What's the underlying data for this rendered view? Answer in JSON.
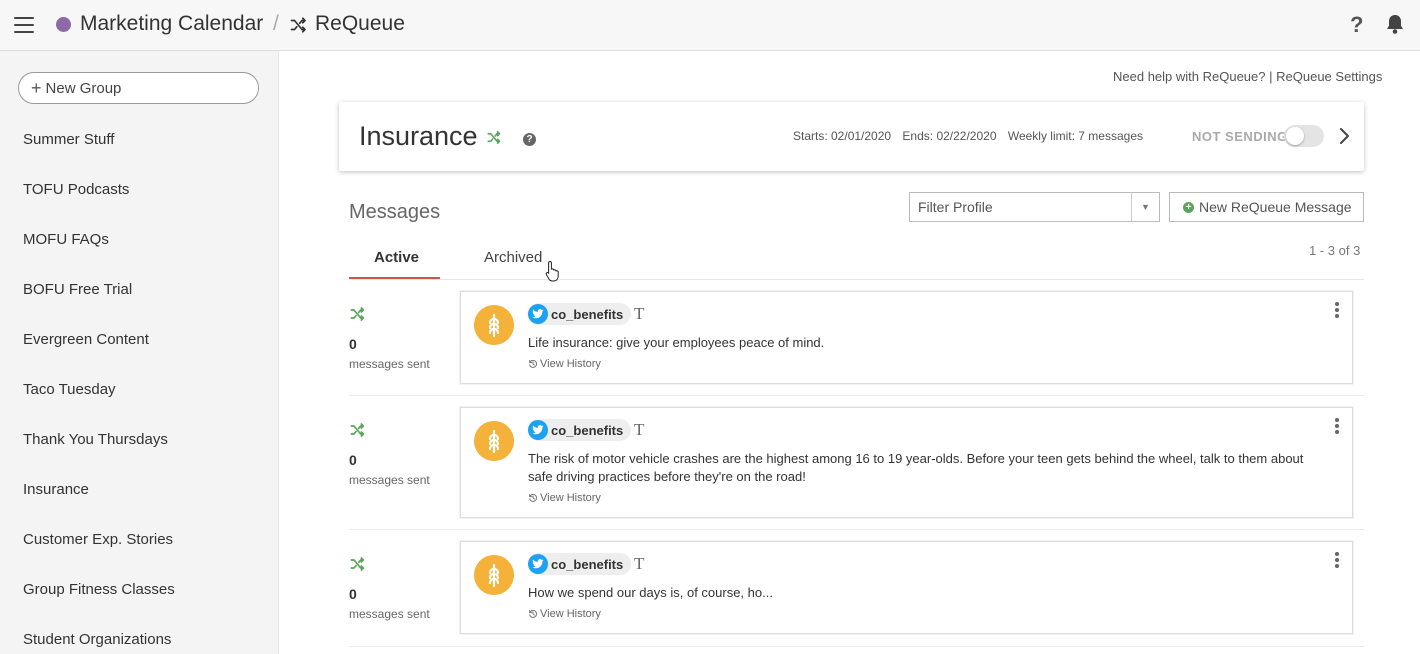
{
  "header": {
    "calendar_name": "Marketing Calendar",
    "separator": "/",
    "current": "ReQueue",
    "help_glyph": "?",
    "calendar_color": "#8c6aa8"
  },
  "sidebar": {
    "new_group_label": "New Group",
    "groups": [
      "Summer Stuff",
      "TOFU Podcasts",
      "MOFU FAQs",
      "BOFU Free Trial",
      "Evergreen Content",
      "Taco Tuesday",
      "Thank You Thursdays",
      "Insurance",
      "Customer Exp. Stories",
      "Group Fitness Classes",
      "Student Organizations"
    ]
  },
  "help_links": {
    "help": "Need help with ReQueue?",
    "divider": "|",
    "settings": "ReQueue Settings"
  },
  "queue": {
    "name": "Insurance",
    "help_glyph": "?",
    "starts": "Starts: 02/01/2020",
    "ends": "Ends: 02/22/2020",
    "weekly_limit": "Weekly limit: 7 messages",
    "status": "NOT SENDING",
    "toggle_on": false
  },
  "messages": {
    "title": "Messages",
    "filter_placeholder": "Filter Profile",
    "new_button": "New ReQueue Message",
    "tabs": [
      "Active",
      "Archived"
    ],
    "active_tab": "Active",
    "pagination": "1 - 3 of 3",
    "items": [
      {
        "count": "0",
        "sent_label": "messages sent",
        "profile": "co_benefits",
        "text": "Life insurance: give your employees peace of mind.",
        "history": "View History"
      },
      {
        "count": "0",
        "sent_label": "messages sent",
        "profile": "co_benefits",
        "text": "The risk of motor vehicle crashes are the highest among 16 to 19 year-olds. Before your teen gets behind the wheel, talk to them about safe driving practices before they're on the road!",
        "history": "View History"
      },
      {
        "count": "0",
        "sent_label": "messages sent",
        "profile": "co_benefits",
        "text": "How we spend our days is, of course, ho...",
        "history": "View History"
      }
    ]
  },
  "colors": {
    "accent_shuffle": "#5aa55a",
    "tab_underline": "#c9584b",
    "avatar": "#f4b23a",
    "twitter": "#1da1f2"
  },
  "icons": [
    "menu-icon",
    "shuffle-icon",
    "help-icon",
    "bell-icon",
    "chevron-right-icon",
    "twitter-icon",
    "text-type-icon",
    "history-icon",
    "kebab-icon",
    "wheat-icon",
    "cursor-icon"
  ]
}
